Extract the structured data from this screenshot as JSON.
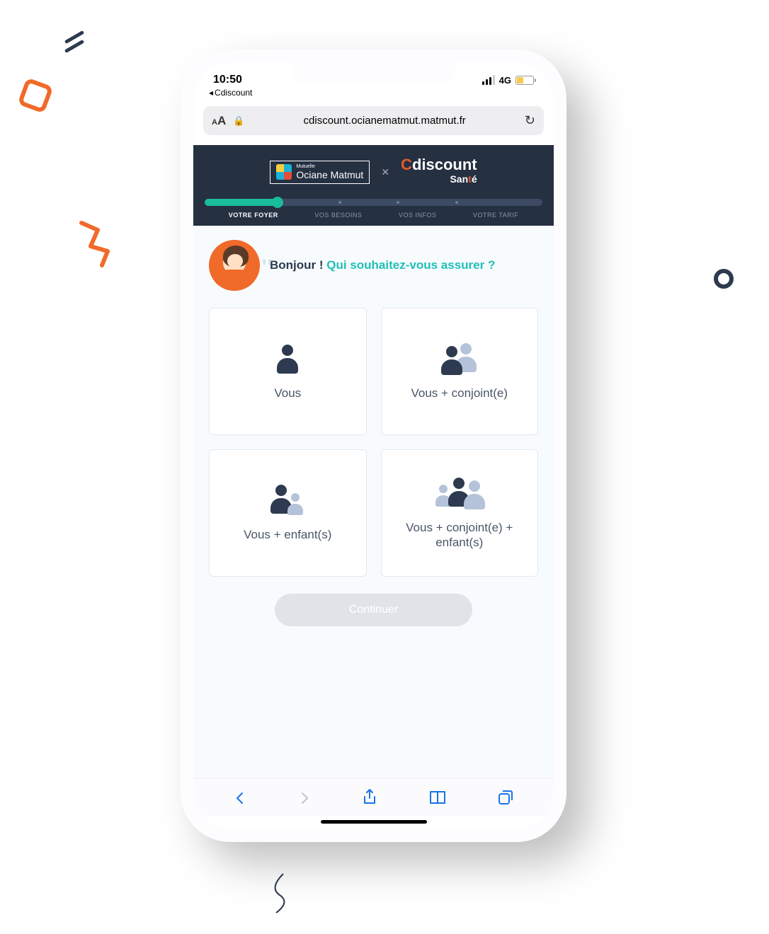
{
  "status": {
    "time": "10:50",
    "back_app": "Cdiscount",
    "network": "4G"
  },
  "browser": {
    "url": "cdiscount.ocianematmut.matmut.fr"
  },
  "header": {
    "brand1_super": "Mutuelle",
    "brand1": "Ociane Matmut",
    "brand2_c": "C",
    "brand2_rest": "discount",
    "brand2_sub_pre": "San",
    "brand2_sub_t": "t",
    "brand2_sub_post": "é"
  },
  "steps": {
    "items": [
      {
        "label": "VOTRE FOYER",
        "active": true
      },
      {
        "label": "VOS BESOINS",
        "active": false
      },
      {
        "label": "VOS INFOS",
        "active": false
      },
      {
        "label": "VOTRE TARIF",
        "active": false
      }
    ]
  },
  "greeting": {
    "hi": "Bonjour ! ",
    "question": "Qui souhaitez-vous assurer ?"
  },
  "options": [
    {
      "label": "Vous"
    },
    {
      "label": "Vous + conjoint(e)"
    },
    {
      "label": "Vous + enfant(s)"
    },
    {
      "label": "Vous + conjoint(e) + enfant(s)"
    }
  ],
  "continue_label": "Continuer",
  "colors": {
    "accent": "#1fbfb8",
    "dark": "#253041",
    "orange": "#f06a2a"
  }
}
